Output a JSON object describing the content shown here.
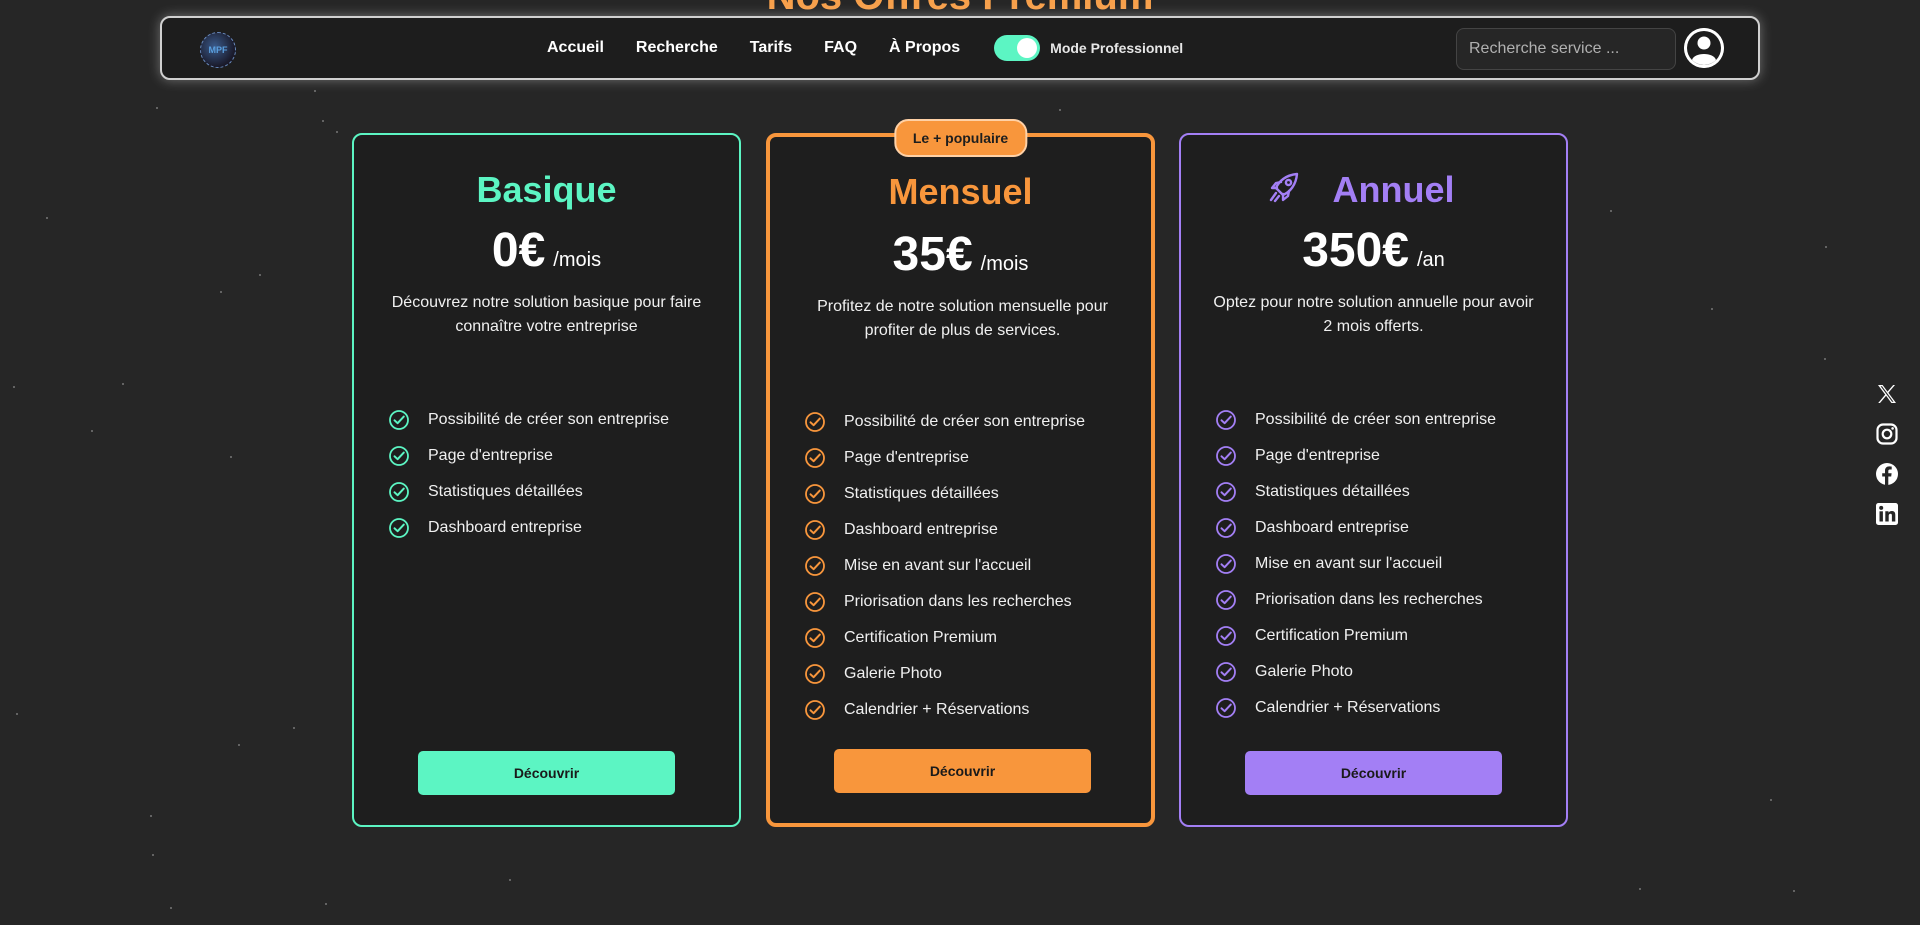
{
  "page": {
    "heading": "Nos Offres Premium"
  },
  "nav": {
    "logo_text": "MPF",
    "links": [
      "Accueil",
      "Recherche",
      "Tarifs",
      "FAQ",
      "À Propos"
    ],
    "mode_label": "Mode Professionnel",
    "search_placeholder": "Recherche service ..."
  },
  "plans": [
    {
      "name": "Basique",
      "price": "0€",
      "period": "/mois",
      "description": "Découvrez notre solution basique pour faire connaître votre entreprise",
      "features": [
        "Possibilité de créer son entreprise",
        "Page d'entreprise",
        "Statistiques détaillées",
        "Dashboard entreprise"
      ],
      "cta": "Découvrir",
      "color": "#5cf5c3"
    },
    {
      "name": "Mensuel",
      "badge": "Le + populaire",
      "price": "35€",
      "period": "/mois",
      "description": "Profitez de notre solution mensuelle pour profiter de plus de services.",
      "features": [
        "Possibilité de créer son entreprise",
        "Page d'entreprise",
        "Statistiques détaillées",
        "Dashboard entreprise",
        "Mise en avant sur l'accueil",
        "Priorisation dans les recherches",
        "Certification Premium",
        "Galerie Photo",
        "Calendrier + Réservations"
      ],
      "cta": "Découvrir",
      "color": "#f8963c"
    },
    {
      "name": "Annuel",
      "price": "350€",
      "period": "/an",
      "description": "Optez pour notre solution annuelle pour avoir 2 mois offerts.",
      "features": [
        "Possibilité de créer son entreprise",
        "Page d'entreprise",
        "Statistiques détaillées",
        "Dashboard entreprise",
        "Mise en avant sur l'accueil",
        "Priorisation dans les recherches",
        "Certification Premium",
        "Galerie Photo",
        "Calendrier + Réservations"
      ],
      "cta": "Découvrir",
      "color": "#a37ff5"
    }
  ],
  "socials": [
    "x-icon",
    "instagram-icon",
    "facebook-icon",
    "linkedin-icon"
  ]
}
